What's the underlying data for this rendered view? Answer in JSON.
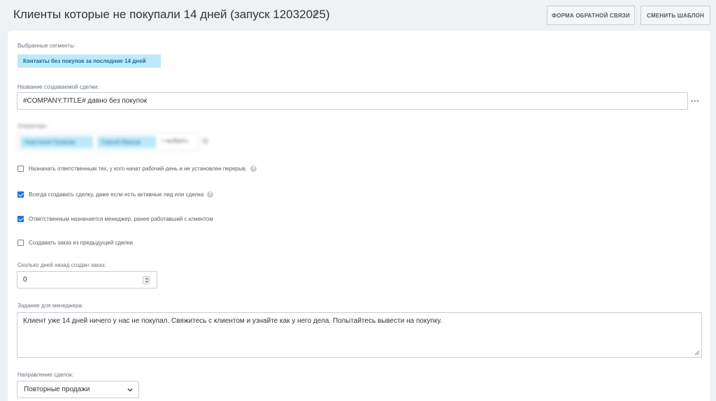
{
  "header": {
    "title": "Клиенты которые не покупали 14 дней (запуск 12032025)",
    "edit_icon": "pencil-icon",
    "feedback_button": "ФОРМА ОБРАТНОЙ СВЯЗИ",
    "change_template_button": "СМЕНИТЬ ШАБЛОН"
  },
  "segments": {
    "label": "Выбранные сегменты",
    "chip": "Контакты без покупок за последние 14 дней"
  },
  "deal_name": {
    "label": "Название создаваемой сделки:",
    "value": "#COMPANY.TITLE# давно без покупок",
    "more_icon": "ellipsis-icon"
  },
  "employees": {
    "label": "Операторы",
    "chips": [
      "Анастасия Громова",
      "Сергей Иванов"
    ],
    "add_label": "+ выбрать"
  },
  "options": [
    {
      "label": "Назначать ответственным тех, у кого начат рабочий день и не установлен перерыв.",
      "checked": false,
      "help": true
    },
    {
      "label": "Всегда создавать сделку, даже если есть активные лид или сделка",
      "checked": true,
      "help": true
    },
    {
      "label": "Ответственным назначается менеджер, ранее работавший с клиентом",
      "checked": true,
      "help": false
    },
    {
      "label": "Создавать заказ из предыдущей сделки",
      "checked": false,
      "help": false
    }
  ],
  "days": {
    "label": "Сколько дней назад создан заказ:",
    "value": "0"
  },
  "task": {
    "label": "Задание для менеджера:",
    "value": "Клиент уже 14 дней ничего у нас не покупал. Свяжитесь с клиентом и узнайте как у него дела. Попытайтесь вывести на покупку."
  },
  "direction": {
    "label": "Направление сделок:",
    "selected": "Повторные продажи"
  },
  "colors": {
    "chip_bg": "#bde9fb",
    "chip_text": "#1a6f93",
    "checkbox_checked": "#1a73e8",
    "page_bg": "#eef2f4"
  }
}
